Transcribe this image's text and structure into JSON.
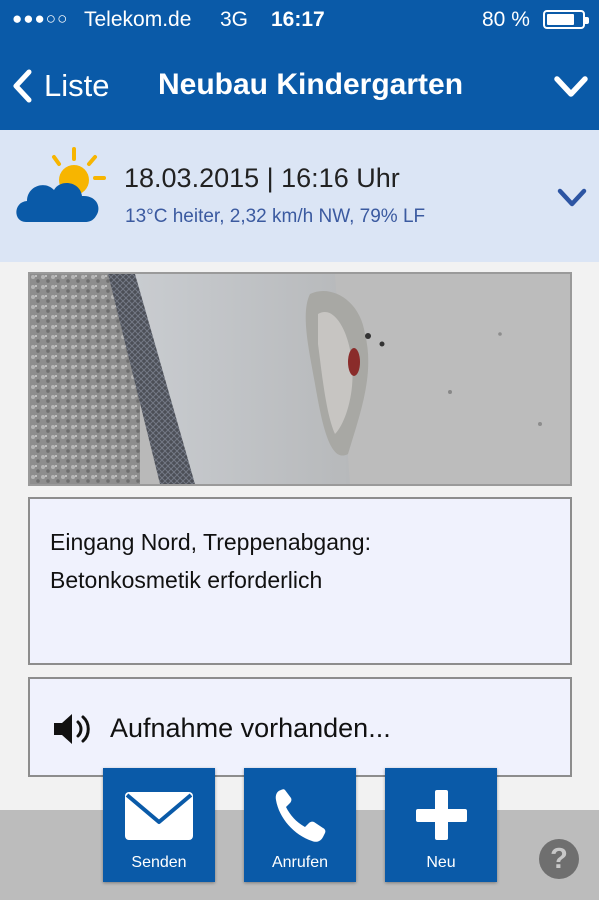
{
  "status_bar": {
    "signal": "●●●○○",
    "carrier": "Telekom.de",
    "network": "3G",
    "time": "16:17",
    "battery": "80 %",
    "battery_level": 0.8
  },
  "nav": {
    "back_label": "Liste",
    "title": "Neubau Kindergarten"
  },
  "weather": {
    "date_time": "18.03.2015 | 16:16 Uhr",
    "conditions": "13°C heiter, 2,32 km/h NW, 79% LF"
  },
  "photo": {
    "icon": "photo-concrete-damage"
  },
  "note": {
    "line1": "Eingang Nord, Treppenabgang:",
    "line2": "Betonkosmetik erforderlich"
  },
  "audio": {
    "label": "Aufnahme vorhanden..."
  },
  "actions": [
    {
      "label": "Senden",
      "icon": "envelope-icon"
    },
    {
      "label": "Anrufen",
      "icon": "phone-icon"
    },
    {
      "label": "Neu",
      "icon": "plus-icon"
    }
  ],
  "help": {
    "label": "?"
  },
  "colors": {
    "brand_blue": "#0a5aa8",
    "weather_bg": "#dbe5f5",
    "weather_text": "#3b5aa0"
  }
}
